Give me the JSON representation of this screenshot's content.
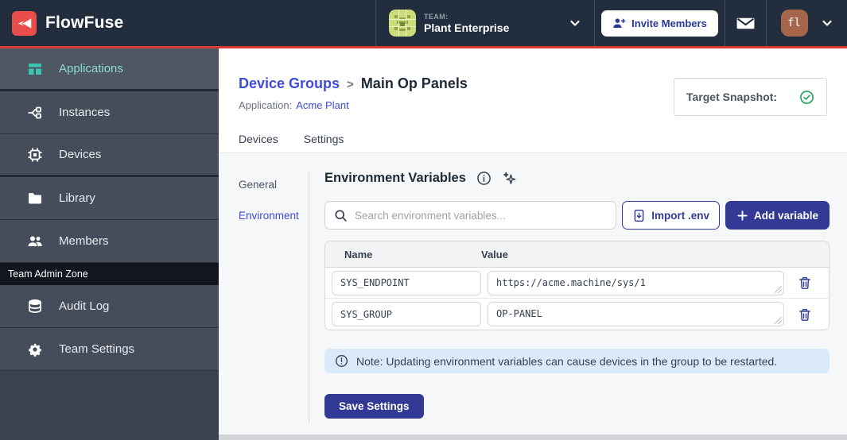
{
  "topbar": {
    "brand": "FlowFuse",
    "team_label": "TEAM:",
    "team_name": "Plant Enterprise",
    "invite_label": "Invite Members",
    "avatar_initials": "fl"
  },
  "sidebar": {
    "items": [
      {
        "label": "Applications",
        "icon": "applications-icon",
        "active": true
      },
      {
        "label": "Instances",
        "icon": "instances-icon"
      },
      {
        "label": "Devices",
        "icon": "devices-icon"
      },
      {
        "label": "Library",
        "icon": "library-icon"
      },
      {
        "label": "Members",
        "icon": "members-icon"
      }
    ],
    "admin_section_label": "Team Admin Zone",
    "admin_items": [
      {
        "label": "Audit Log",
        "icon": "audit-log-icon"
      },
      {
        "label": "Team Settings",
        "icon": "gear-icon"
      }
    ]
  },
  "header": {
    "breadcrumb_parent": "Device Groups",
    "breadcrumb_separator": ">",
    "breadcrumb_current": "Main Op Panels",
    "application_label": "Application:",
    "application_name": "Acme Plant",
    "target_snapshot_label": "Target Snapshot:"
  },
  "tabs": [
    {
      "label": "Devices"
    },
    {
      "label": "Settings",
      "active": true
    }
  ],
  "settings_nav": [
    {
      "label": "General"
    },
    {
      "label": "Environment",
      "active": true
    }
  ],
  "env": {
    "title": "Environment Variables",
    "search_placeholder": "Search environment variables...",
    "import_label": "Import .env",
    "add_label": "Add variable",
    "table": {
      "columns": [
        "Name",
        "Value"
      ],
      "rows": [
        {
          "name": "SYS_ENDPOINT",
          "value": "https://acme.machine/sys/1"
        },
        {
          "name": "SYS_GROUP",
          "value": "OP-PANEL"
        }
      ]
    },
    "note": "Note: Updating environment variables can cause devices in the group to be restarted.",
    "save_label": "Save Settings"
  },
  "colors": {
    "topbar_bg": "#222E3E",
    "accent_red": "#DC3832",
    "sidebar_bg": "#454D5B",
    "sidebar_active_text": "#8BDCC7",
    "primary_indigo": "#323A96",
    "link_indigo": "#3F4CD9",
    "snapshot_check_green": "#1CA35C",
    "note_bg": "#DBEAFB"
  }
}
